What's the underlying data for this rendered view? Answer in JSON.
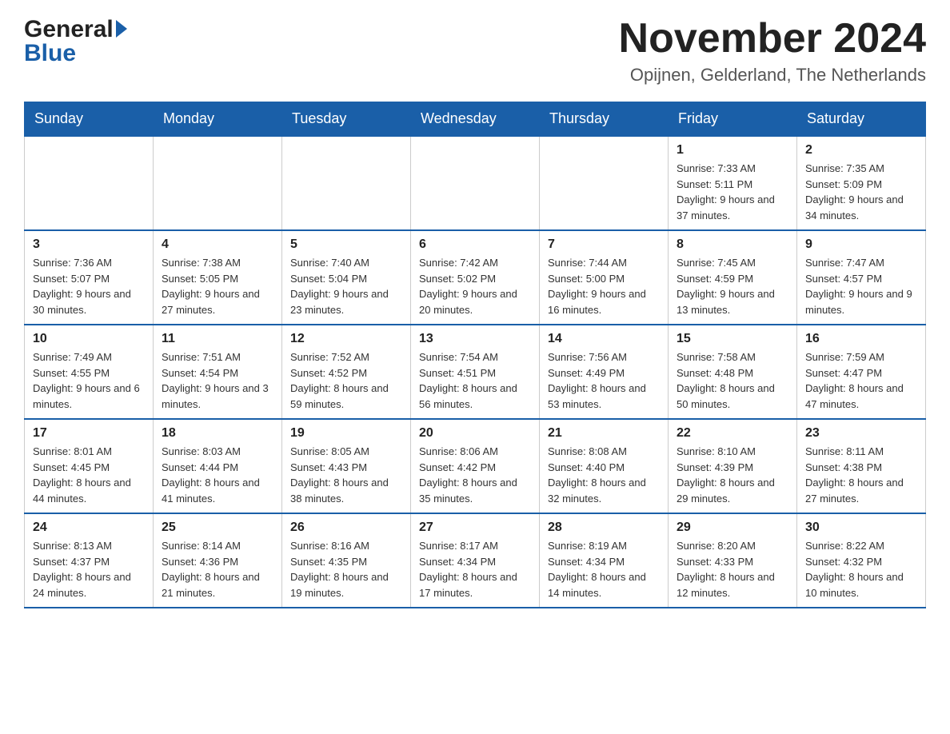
{
  "header": {
    "logo_general": "General",
    "logo_blue": "Blue",
    "month_title": "November 2024",
    "location": "Opijnen, Gelderland, The Netherlands"
  },
  "days_of_week": [
    "Sunday",
    "Monday",
    "Tuesday",
    "Wednesday",
    "Thursday",
    "Friday",
    "Saturday"
  ],
  "weeks": [
    [
      {
        "day": "",
        "info": ""
      },
      {
        "day": "",
        "info": ""
      },
      {
        "day": "",
        "info": ""
      },
      {
        "day": "",
        "info": ""
      },
      {
        "day": "",
        "info": ""
      },
      {
        "day": "1",
        "info": "Sunrise: 7:33 AM\nSunset: 5:11 PM\nDaylight: 9 hours and 37 minutes."
      },
      {
        "day": "2",
        "info": "Sunrise: 7:35 AM\nSunset: 5:09 PM\nDaylight: 9 hours and 34 minutes."
      }
    ],
    [
      {
        "day": "3",
        "info": "Sunrise: 7:36 AM\nSunset: 5:07 PM\nDaylight: 9 hours and 30 minutes."
      },
      {
        "day": "4",
        "info": "Sunrise: 7:38 AM\nSunset: 5:05 PM\nDaylight: 9 hours and 27 minutes."
      },
      {
        "day": "5",
        "info": "Sunrise: 7:40 AM\nSunset: 5:04 PM\nDaylight: 9 hours and 23 minutes."
      },
      {
        "day": "6",
        "info": "Sunrise: 7:42 AM\nSunset: 5:02 PM\nDaylight: 9 hours and 20 minutes."
      },
      {
        "day": "7",
        "info": "Sunrise: 7:44 AM\nSunset: 5:00 PM\nDaylight: 9 hours and 16 minutes."
      },
      {
        "day": "8",
        "info": "Sunrise: 7:45 AM\nSunset: 4:59 PM\nDaylight: 9 hours and 13 minutes."
      },
      {
        "day": "9",
        "info": "Sunrise: 7:47 AM\nSunset: 4:57 PM\nDaylight: 9 hours and 9 minutes."
      }
    ],
    [
      {
        "day": "10",
        "info": "Sunrise: 7:49 AM\nSunset: 4:55 PM\nDaylight: 9 hours and 6 minutes."
      },
      {
        "day": "11",
        "info": "Sunrise: 7:51 AM\nSunset: 4:54 PM\nDaylight: 9 hours and 3 minutes."
      },
      {
        "day": "12",
        "info": "Sunrise: 7:52 AM\nSunset: 4:52 PM\nDaylight: 8 hours and 59 minutes."
      },
      {
        "day": "13",
        "info": "Sunrise: 7:54 AM\nSunset: 4:51 PM\nDaylight: 8 hours and 56 minutes."
      },
      {
        "day": "14",
        "info": "Sunrise: 7:56 AM\nSunset: 4:49 PM\nDaylight: 8 hours and 53 minutes."
      },
      {
        "day": "15",
        "info": "Sunrise: 7:58 AM\nSunset: 4:48 PM\nDaylight: 8 hours and 50 minutes."
      },
      {
        "day": "16",
        "info": "Sunrise: 7:59 AM\nSunset: 4:47 PM\nDaylight: 8 hours and 47 minutes."
      }
    ],
    [
      {
        "day": "17",
        "info": "Sunrise: 8:01 AM\nSunset: 4:45 PM\nDaylight: 8 hours and 44 minutes."
      },
      {
        "day": "18",
        "info": "Sunrise: 8:03 AM\nSunset: 4:44 PM\nDaylight: 8 hours and 41 minutes."
      },
      {
        "day": "19",
        "info": "Sunrise: 8:05 AM\nSunset: 4:43 PM\nDaylight: 8 hours and 38 minutes."
      },
      {
        "day": "20",
        "info": "Sunrise: 8:06 AM\nSunset: 4:42 PM\nDaylight: 8 hours and 35 minutes."
      },
      {
        "day": "21",
        "info": "Sunrise: 8:08 AM\nSunset: 4:40 PM\nDaylight: 8 hours and 32 minutes."
      },
      {
        "day": "22",
        "info": "Sunrise: 8:10 AM\nSunset: 4:39 PM\nDaylight: 8 hours and 29 minutes."
      },
      {
        "day": "23",
        "info": "Sunrise: 8:11 AM\nSunset: 4:38 PM\nDaylight: 8 hours and 27 minutes."
      }
    ],
    [
      {
        "day": "24",
        "info": "Sunrise: 8:13 AM\nSunset: 4:37 PM\nDaylight: 8 hours and 24 minutes."
      },
      {
        "day": "25",
        "info": "Sunrise: 8:14 AM\nSunset: 4:36 PM\nDaylight: 8 hours and 21 minutes."
      },
      {
        "day": "26",
        "info": "Sunrise: 8:16 AM\nSunset: 4:35 PM\nDaylight: 8 hours and 19 minutes."
      },
      {
        "day": "27",
        "info": "Sunrise: 8:17 AM\nSunset: 4:34 PM\nDaylight: 8 hours and 17 minutes."
      },
      {
        "day": "28",
        "info": "Sunrise: 8:19 AM\nSunset: 4:34 PM\nDaylight: 8 hours and 14 minutes."
      },
      {
        "day": "29",
        "info": "Sunrise: 8:20 AM\nSunset: 4:33 PM\nDaylight: 8 hours and 12 minutes."
      },
      {
        "day": "30",
        "info": "Sunrise: 8:22 AM\nSunset: 4:32 PM\nDaylight: 8 hours and 10 minutes."
      }
    ]
  ]
}
